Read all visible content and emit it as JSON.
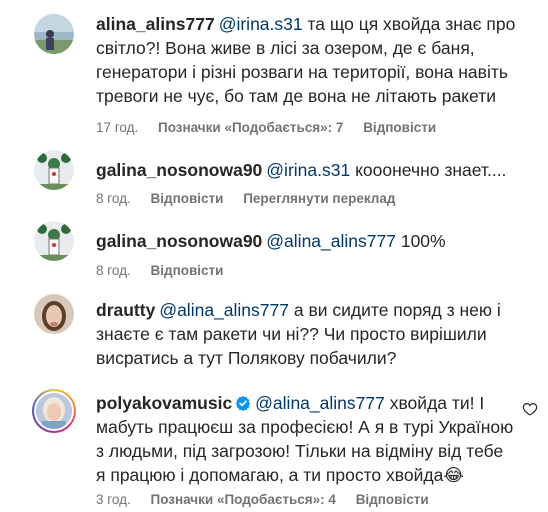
{
  "comments": [
    {
      "username": "alina_alins777",
      "mention": "@irina.s31",
      "text": " та що ця хвойда знає про світло?! Вона живе в лісі за озером, де є баня, генератори і різні розваги на території, вона навіть тревоги не чує, бо там де вона не літають ракети",
      "time": "17 год.",
      "likes": "Позначки «Подобається»: 7",
      "reply": "Відповісти"
    },
    {
      "username": "galina_nosonowa90",
      "mention": "@irina.s31",
      "text": " кооонечно знает....",
      "time": "8 год.",
      "reply": "Відповісти",
      "translate": "Переглянути переклад"
    },
    {
      "username": "galina_nosonowa90",
      "mention": "@alina_alins777",
      "text": " 100%",
      "time": "8 год.",
      "reply": "Відповісти"
    },
    {
      "username": "drautty",
      "mention": "@alina_alins777",
      "text": " а ви сидите поряд з нею і знаєте є там ракети чи ні?? Чи просто вирішили висратись а тут Полякову побачили?",
      "reply": ""
    },
    {
      "username": "polyakovamusic",
      "verified": true,
      "mention": "@alina_alins777",
      "text": " хвойда ти! І мабуть працюєш за професією! А я в турі Україною з людьми, під загрозою! Тільки на відміну від тебе я працюю і допомагаю, а ти просто хвойда😂",
      "time": "3 год.",
      "likes": "Позначки «Подобається»: 4",
      "reply": "Відповісти"
    }
  ],
  "colors": {
    "text": "#262626",
    "mention": "#00376b",
    "meta": "#737373",
    "verified": "#0095f6"
  },
  "icons": {
    "verified": "verified-badge-icon",
    "like": "heart-icon"
  }
}
